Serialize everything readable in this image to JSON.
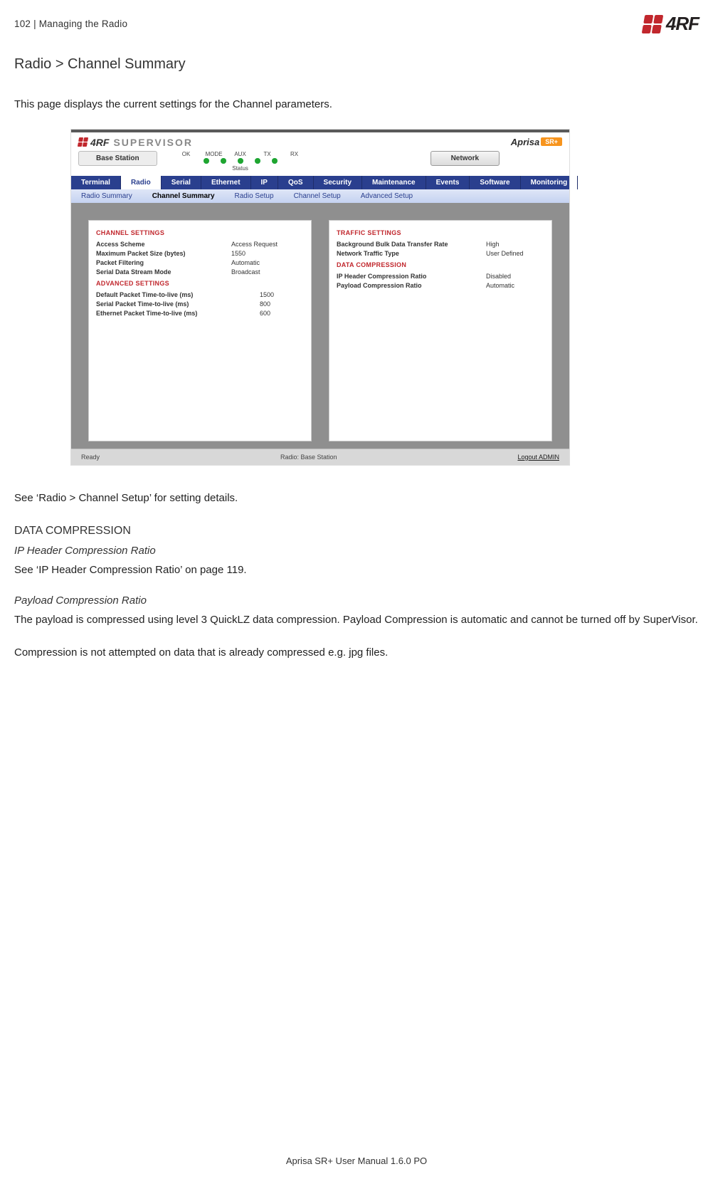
{
  "header": {
    "left": "102  |  Managing the Radio",
    "brand": "4RF"
  },
  "title": "Radio > Channel Summary",
  "intro": "This page displays the current settings for the Channel parameters.",
  "screenshot": {
    "supervisor_word": "SUPERVISOR",
    "aprisa_label": "Aprisa",
    "aprisa_plus": "SR+",
    "base_station": "Base Station",
    "led_labels": [
      "OK",
      "MODE",
      "AUX",
      "TX",
      "RX"
    ],
    "status_word": "Status",
    "network_button": "Network",
    "main_tabs": [
      "Terminal",
      "Radio",
      "Serial",
      "Ethernet",
      "IP",
      "QoS",
      "Security",
      "Maintenance",
      "Events",
      "Software",
      "Monitoring"
    ],
    "main_tab_active_index": 1,
    "sub_tabs": [
      "Radio Summary",
      "Channel Summary",
      "Radio Setup",
      "Channel Setup",
      "Advanced Setup"
    ],
    "sub_tab_active_index": 1,
    "left_panel": {
      "channel_settings_head": "CHANNEL SETTINGS",
      "rows": [
        {
          "k": "Access Scheme",
          "v": "Access Request"
        },
        {
          "k": "Maximum Packet Size (bytes)",
          "v": "1550"
        },
        {
          "k": "Packet Filtering",
          "v": "Automatic"
        },
        {
          "k": "Serial Data Stream Mode",
          "v": "Broadcast"
        }
      ],
      "advanced_head": "ADVANCED SETTINGS",
      "adv_rows": [
        {
          "k": "Default Packet Time-to-live (ms)",
          "v": "1500"
        },
        {
          "k": "Serial Packet Time-to-live (ms)",
          "v": "800"
        },
        {
          "k": "Ethernet Packet Time-to-live (ms)",
          "v": "600"
        }
      ]
    },
    "right_panel": {
      "traffic_head": "TRAFFIC SETTINGS",
      "traffic_rows": [
        {
          "k": "Background Bulk Data Transfer Rate",
          "v": "High"
        },
        {
          "k": "Network Traffic Type",
          "v": "User Defined"
        }
      ],
      "compression_head": "DATA COMPRESSION",
      "compression_rows": [
        {
          "k": "IP Header Compression Ratio",
          "v": "Disabled"
        },
        {
          "k": "Payload Compression Ratio",
          "v": "Automatic"
        }
      ]
    },
    "footer": {
      "ready": "Ready",
      "radio_info": "Radio: Base Station",
      "logout": "Logout ADMIN"
    }
  },
  "see_channel_setup": "See ‘Radio > Channel Setup’ for setting details.",
  "section_dc": "DATA COMPRESSION",
  "section_ip_ratio": "IP Header Compression Ratio",
  "see_ip_ratio": "See ‘IP Header Compression Ratio’ on page 119.",
  "section_payload": "Payload Compression Ratio",
  "payload_p1": "The payload is compressed using level 3 QuickLZ data compression. Payload Compression is automatic and cannot be turned off by SuperVisor.",
  "payload_p2": "Compression is not attempted on data that is already compressed e.g. jpg files.",
  "doc_footer": "Aprisa SR+ User Manual 1.6.0 PO"
}
